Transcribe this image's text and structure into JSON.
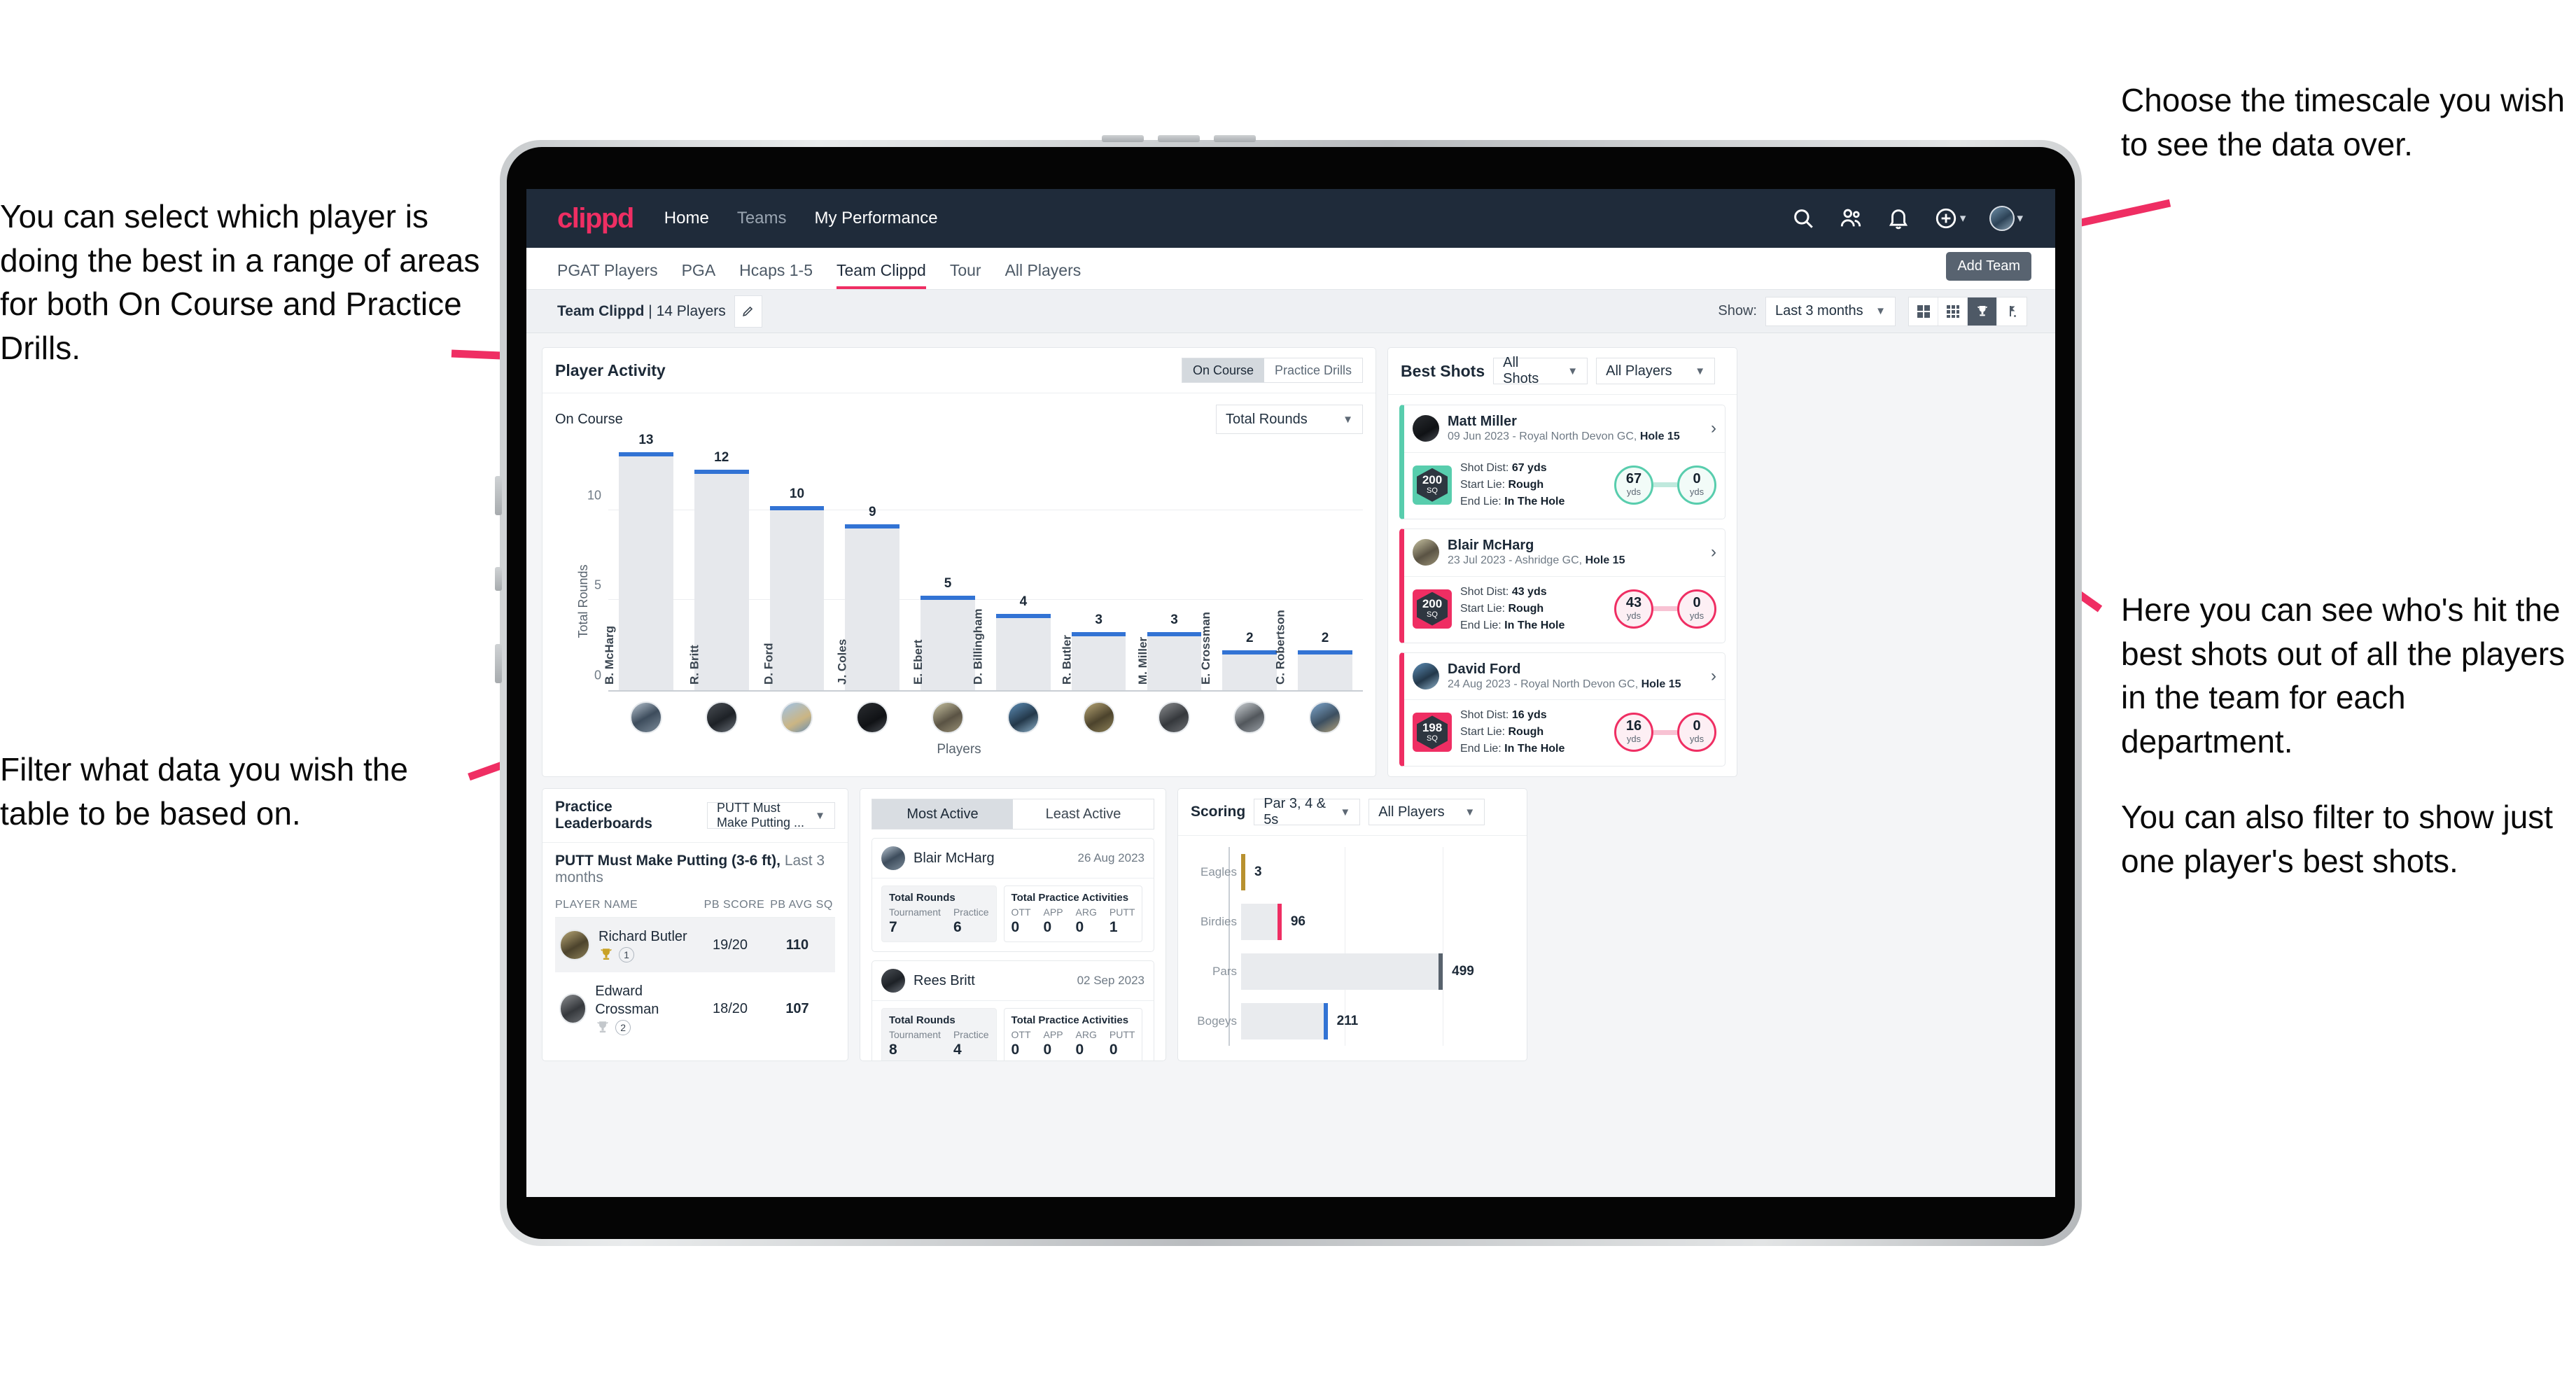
{
  "annotations": {
    "left_top": "You can select which player is doing the best in a range of areas for both On Course and Practice Drills.",
    "left_bottom": "Filter what data you wish the table to be based on.",
    "right_top": "Choose the timescale you wish to see the data over.",
    "right_mid": "Here you can see who's hit the best shots out of all the players in the team for each department.",
    "right_bottom": "You can also filter to show just one player's best shots."
  },
  "colors": {
    "accent": "#ef2e63",
    "navy": "#1f2b3a",
    "teal": "#58cdad",
    "blue": "#3273d4",
    "gold": "#b8912f"
  },
  "topnav": {
    "logo": "clippd",
    "links": [
      {
        "label": "Home"
      },
      {
        "label": "Teams"
      },
      {
        "label": "My Performance"
      }
    ],
    "icons": [
      "search-icon",
      "people-icon",
      "bell-icon",
      "plus-circle-icon",
      "avatar"
    ]
  },
  "tabs": [
    {
      "label": "PGAT Players",
      "active": false
    },
    {
      "label": "PGA",
      "active": false
    },
    {
      "label": "Hcaps 1-5",
      "active": false
    },
    {
      "label": "Team Clippd",
      "active": true
    },
    {
      "label": "Tour",
      "active": false
    },
    {
      "label": "All Players",
      "active": false
    }
  ],
  "tooltip": "Add Team",
  "subbar": {
    "team_name": "Team Clippd",
    "team_separator": " | ",
    "team_count": "14 Players",
    "show_label": "Show:",
    "timescale": "Last 3 months",
    "view_toggles": [
      "grid-2x2-icon",
      "grid-3x3-icon",
      "trophy-icon",
      "golf-flag-icon"
    ],
    "active_toggle_index": 2
  },
  "player_activity": {
    "title": "Player Activity",
    "segments": [
      {
        "label": "On Course",
        "active": true
      },
      {
        "label": "Practice Drills",
        "active": false
      }
    ],
    "sub_label": "On Course",
    "metric_select": "Total Rounds"
  },
  "chart_data": [
    {
      "type": "bar",
      "title": "Player Activity - On Course",
      "categories": [
        "B. McHarg",
        "R. Britt",
        "D. Ford",
        "J. Coles",
        "E. Ebert",
        "D. Billingham",
        "R. Butler",
        "M. Miller",
        "E. Crossman",
        "C. Robertson"
      ],
      "values": [
        13,
        12,
        10,
        9,
        5,
        4,
        3,
        3,
        2,
        2
      ],
      "xlabel": "Players",
      "ylabel": "Total Rounds",
      "yticks": [
        0,
        5,
        10
      ],
      "ylim": [
        0,
        14
      ],
      "grid": true,
      "legend": "none"
    },
    {
      "type": "bar",
      "orientation": "horizontal",
      "title": "Scoring",
      "categories": [
        "Eagles",
        "Birdies",
        "Pars",
        "Bogeys"
      ],
      "values": [
        3,
        96,
        499,
        211
      ],
      "colors": [
        "#b8912f",
        "#ef2e63",
        "#58626d",
        "#3273d4"
      ],
      "xlabel": "",
      "ylabel": "",
      "grid": true,
      "legend": "none"
    }
  ],
  "best_shots": {
    "title": "Best Shots",
    "shot_filter": "All Shots",
    "player_filter": "All Players",
    "shots": [
      {
        "name": "Matt Miller",
        "meta_date": "09 Jun 2023 - Royal North Devon GC,",
        "meta_hole": "Hole 15",
        "sq": "200",
        "sq_unit": "SQ",
        "accent": "teal",
        "shot_dist_label": "Shot Dist:",
        "shot_dist": "67 yds",
        "start_lie_label": "Start Lie:",
        "start_lie": "Rough",
        "end_lie_label": "End Lie:",
        "end_lie": "In The Hole",
        "from_val": "67",
        "from_unit": "yds",
        "to_val": "0",
        "to_unit": "yds"
      },
      {
        "name": "Blair McHarg",
        "meta_date": "23 Jul 2023 - Ashridge GC,",
        "meta_hole": "Hole 15",
        "sq": "200",
        "sq_unit": "SQ",
        "accent": "pink",
        "shot_dist_label": "Shot Dist:",
        "shot_dist": "43 yds",
        "start_lie_label": "Start Lie:",
        "start_lie": "Rough",
        "end_lie_label": "End Lie:",
        "end_lie": "In The Hole",
        "from_val": "43",
        "from_unit": "yds",
        "to_val": "0",
        "to_unit": "yds"
      },
      {
        "name": "David Ford",
        "meta_date": "24 Aug 2023 - Royal North Devon GC,",
        "meta_hole": "Hole 15",
        "sq": "198",
        "sq_unit": "SQ",
        "accent": "pink",
        "shot_dist_label": "Shot Dist:",
        "shot_dist": "16 yds",
        "start_lie_label": "Start Lie:",
        "start_lie": "Rough",
        "end_lie_label": "End Lie:",
        "end_lie": "In The Hole",
        "from_val": "16",
        "from_unit": "yds",
        "to_val": "0",
        "to_unit": "yds"
      }
    ]
  },
  "practice_leaderboards": {
    "title": "Practice Leaderboards",
    "drill_select": "PUTT Must Make Putting ...",
    "subtitle_bold": "PUTT Must Make Putting (3-6 ft),",
    "subtitle_light": " Last 3 months",
    "columns": [
      "PLAYER NAME",
      "PB SCORE",
      "PB AVG SQ"
    ],
    "rows": [
      {
        "name": "Richard Butler",
        "rank": "1",
        "pb_score": "19/20",
        "pb_avg_sq": "110"
      },
      {
        "name": "Edward Crossman",
        "rank": "2",
        "pb_score": "18/20",
        "pb_avg_sq": "107"
      }
    ]
  },
  "activity": {
    "tabs": [
      {
        "label": "Most Active",
        "active": true
      },
      {
        "label": "Least Active",
        "active": false
      }
    ],
    "items": [
      {
        "name": "Blair McHarg",
        "date": "26 Aug 2023",
        "rounds_title": "Total Rounds",
        "rounds_cols": [
          "Tournament",
          "Practice"
        ],
        "rounds_vals": [
          "7",
          "6"
        ],
        "practice_title": "Total Practice Activities",
        "practice_cols": [
          "OTT",
          "APP",
          "ARG",
          "PUTT"
        ],
        "practice_vals": [
          "0",
          "0",
          "0",
          "1"
        ]
      },
      {
        "name": "Rees Britt",
        "date": "02 Sep 2023",
        "rounds_title": "Total Rounds",
        "rounds_cols": [
          "Tournament",
          "Practice"
        ],
        "rounds_vals": [
          "8",
          "4"
        ],
        "practice_title": "Total Practice Activities",
        "practice_cols": [
          "OTT",
          "APP",
          "ARG",
          "PUTT"
        ],
        "practice_vals": [
          "0",
          "0",
          "0",
          "0"
        ]
      }
    ]
  },
  "scoring": {
    "title": "Scoring",
    "par_filter": "Par 3, 4 & 5s",
    "player_filter": "All Players"
  }
}
